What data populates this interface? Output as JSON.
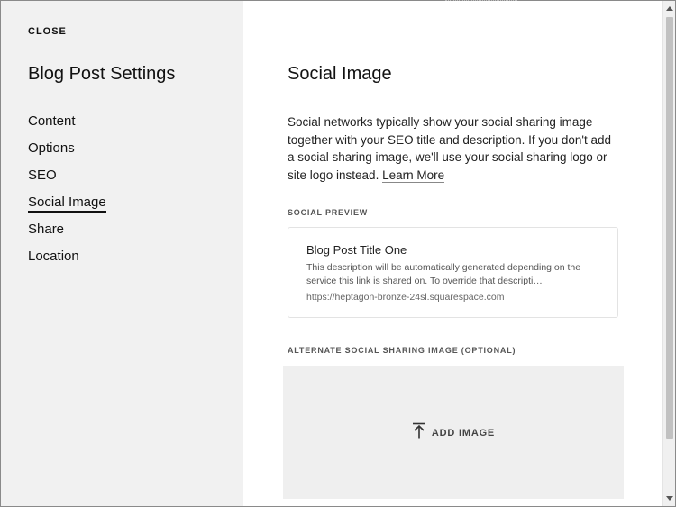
{
  "sidebar": {
    "close_label": "CLOSE",
    "title": "Blog Post Settings",
    "items": [
      {
        "label": "Content"
      },
      {
        "label": "Options"
      },
      {
        "label": "SEO"
      },
      {
        "label": "Social Image"
      },
      {
        "label": "Share"
      },
      {
        "label": "Location"
      }
    ],
    "active_item": "Social Image"
  },
  "main": {
    "title": "Social Image",
    "description": "Social networks typically show your social sharing image together with your SEO title and description. If you don't add a social sharing image, we'll use your social sharing logo or site logo instead.",
    "learn_more_label": "Learn More",
    "preview_label": "SOCIAL PREVIEW",
    "preview": {
      "title": "Blog Post Title One",
      "description": "This description will be automatically generated depending on the service this link is shared on. To override that descripti…",
      "url": "https://heptagon-bronze-24sl.squarespace.com"
    },
    "alt_image_label": "ALTERNATE SOCIAL SHARING IMAGE (OPTIONAL)",
    "add_image_label": "ADD IMAGE",
    "add_image_icon": "upload-icon"
  },
  "colors": {
    "sidebar_bg": "#f1f1f1",
    "dropzone_bg": "#efefef",
    "text": "#111111"
  }
}
